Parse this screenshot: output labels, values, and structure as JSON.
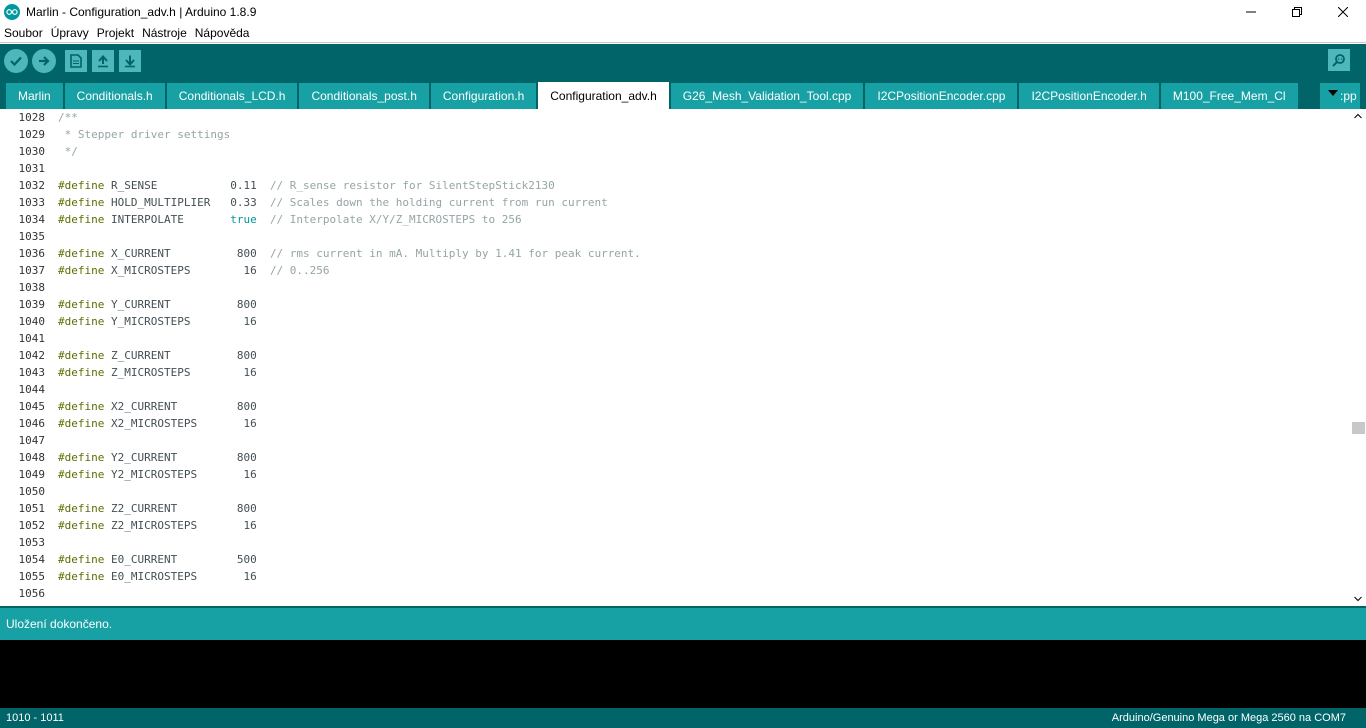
{
  "window": {
    "title": "Marlin - Configuration_adv.h | Arduino 1.8.9"
  },
  "menu": [
    "Soubor",
    "Úpravy",
    "Projekt",
    "Nástroje",
    "Nápověda"
  ],
  "toolbar": {
    "verify": "verify-icon",
    "upload": "upload-icon",
    "new": "new-file-icon",
    "open": "open-icon",
    "save": "save-icon",
    "serial_monitor": "serial-monitor-icon"
  },
  "tabs": [
    {
      "label": "Marlin",
      "active": false
    },
    {
      "label": "Conditionals.h",
      "active": false
    },
    {
      "label": "Conditionals_LCD.h",
      "active": false
    },
    {
      "label": "Conditionals_post.h",
      "active": false
    },
    {
      "label": "Configuration.h",
      "active": false
    },
    {
      "label": "Configuration_adv.h",
      "active": true
    },
    {
      "label": "G26_Mesh_Validation_Tool.cpp",
      "active": false
    },
    {
      "label": "I2CPositionEncoder.cpp",
      "active": false
    },
    {
      "label": "I2CPositionEncoder.h",
      "active": false
    },
    {
      "label": "M100_Free_Mem_Cl",
      "active": false
    }
  ],
  "tab_overflow_ext": ":pp",
  "code_lines": [
    {
      "n": "1028",
      "parts": [
        {
          "c": "cm",
          "t": "/**"
        }
      ]
    },
    {
      "n": "1029",
      "parts": [
        {
          "c": "cm",
          "t": " * Stepper driver settings"
        }
      ]
    },
    {
      "n": "1030",
      "parts": [
        {
          "c": "cm",
          "t": " */"
        }
      ]
    },
    {
      "n": "1031",
      "parts": []
    },
    {
      "n": "1032",
      "parts": [
        {
          "c": "kw",
          "t": "#define"
        },
        {
          "c": "id",
          "t": " R_SENSE          "
        },
        {
          "c": "tx",
          "t": " 0.11  "
        },
        {
          "c": "cm",
          "t": "// R_sense resistor for SilentStepStick2130"
        }
      ]
    },
    {
      "n": "1033",
      "parts": [
        {
          "c": "kw",
          "t": "#define"
        },
        {
          "c": "id",
          "t": " HOLD_MULTIPLIER  "
        },
        {
          "c": "tx",
          "t": " 0.33  "
        },
        {
          "c": "cm",
          "t": "// Scales down the holding current from run current"
        }
      ]
    },
    {
      "n": "1034",
      "parts": [
        {
          "c": "kw",
          "t": "#define"
        },
        {
          "c": "id",
          "t": " INTERPOLATE      "
        },
        {
          "c": "lit",
          "t": " true  "
        },
        {
          "c": "cm",
          "t": "// Interpolate X/Y/Z_MICROSTEPS to 256"
        }
      ]
    },
    {
      "n": "1035",
      "parts": []
    },
    {
      "n": "1036",
      "parts": [
        {
          "c": "kw",
          "t": "#define"
        },
        {
          "c": "id",
          "t": " X_CURRENT        "
        },
        {
          "c": "tx",
          "t": "  800  "
        },
        {
          "c": "cm",
          "t": "// rms current in mA. Multiply by 1.41 for peak current."
        }
      ]
    },
    {
      "n": "1037",
      "parts": [
        {
          "c": "kw",
          "t": "#define"
        },
        {
          "c": "id",
          "t": " X_MICROSTEPS     "
        },
        {
          "c": "tx",
          "t": "   16  "
        },
        {
          "c": "cm",
          "t": "// 0..256"
        }
      ]
    },
    {
      "n": "1038",
      "parts": []
    },
    {
      "n": "1039",
      "parts": [
        {
          "c": "kw",
          "t": "#define"
        },
        {
          "c": "id",
          "t": " Y_CURRENT        "
        },
        {
          "c": "tx",
          "t": "  800"
        }
      ]
    },
    {
      "n": "1040",
      "parts": [
        {
          "c": "kw",
          "t": "#define"
        },
        {
          "c": "id",
          "t": " Y_MICROSTEPS     "
        },
        {
          "c": "tx",
          "t": "   16"
        }
      ]
    },
    {
      "n": "1041",
      "parts": []
    },
    {
      "n": "1042",
      "parts": [
        {
          "c": "kw",
          "t": "#define"
        },
        {
          "c": "id",
          "t": " Z_CURRENT        "
        },
        {
          "c": "tx",
          "t": "  800"
        }
      ]
    },
    {
      "n": "1043",
      "parts": [
        {
          "c": "kw",
          "t": "#define"
        },
        {
          "c": "id",
          "t": " Z_MICROSTEPS     "
        },
        {
          "c": "tx",
          "t": "   16"
        }
      ]
    },
    {
      "n": "1044",
      "parts": []
    },
    {
      "n": "1045",
      "parts": [
        {
          "c": "kw",
          "t": "#define"
        },
        {
          "c": "id",
          "t": " X2_CURRENT       "
        },
        {
          "c": "tx",
          "t": "  800"
        }
      ]
    },
    {
      "n": "1046",
      "parts": [
        {
          "c": "kw",
          "t": "#define"
        },
        {
          "c": "id",
          "t": " X2_MICROSTEPS    "
        },
        {
          "c": "tx",
          "t": "   16"
        }
      ]
    },
    {
      "n": "1047",
      "parts": []
    },
    {
      "n": "1048",
      "parts": [
        {
          "c": "kw",
          "t": "#define"
        },
        {
          "c": "id",
          "t": " Y2_CURRENT       "
        },
        {
          "c": "tx",
          "t": "  800"
        }
      ]
    },
    {
      "n": "1049",
      "parts": [
        {
          "c": "kw",
          "t": "#define"
        },
        {
          "c": "id",
          "t": " Y2_MICROSTEPS    "
        },
        {
          "c": "tx",
          "t": "   16"
        }
      ]
    },
    {
      "n": "1050",
      "parts": []
    },
    {
      "n": "1051",
      "parts": [
        {
          "c": "kw",
          "t": "#define"
        },
        {
          "c": "id",
          "t": " Z2_CURRENT       "
        },
        {
          "c": "tx",
          "t": "  800"
        }
      ]
    },
    {
      "n": "1052",
      "parts": [
        {
          "c": "kw",
          "t": "#define"
        },
        {
          "c": "id",
          "t": " Z2_MICROSTEPS    "
        },
        {
          "c": "tx",
          "t": "   16"
        }
      ]
    },
    {
      "n": "1053",
      "parts": []
    },
    {
      "n": "1054",
      "parts": [
        {
          "c": "kw",
          "t": "#define"
        },
        {
          "c": "id",
          "t": " E0_CURRENT       "
        },
        {
          "c": "tx",
          "t": "  500"
        }
      ]
    },
    {
      "n": "1055",
      "parts": [
        {
          "c": "kw",
          "t": "#define"
        },
        {
          "c": "id",
          "t": " E0_MICROSTEPS    "
        },
        {
          "c": "tx",
          "t": "   16"
        }
      ]
    },
    {
      "n": "1056",
      "parts": []
    }
  ],
  "status": {
    "message": "Uložení dokončeno."
  },
  "footer": {
    "line_range": "1010 - 1011",
    "board": "Arduino/Genuino Mega or Mega 2560 na COM7"
  },
  "colors": {
    "toolbar_bg": "#006468",
    "tab_bg": "#17a1a5",
    "keyword": "#5e6d03",
    "comment": "#95a5a6",
    "literal": "#00979c"
  }
}
